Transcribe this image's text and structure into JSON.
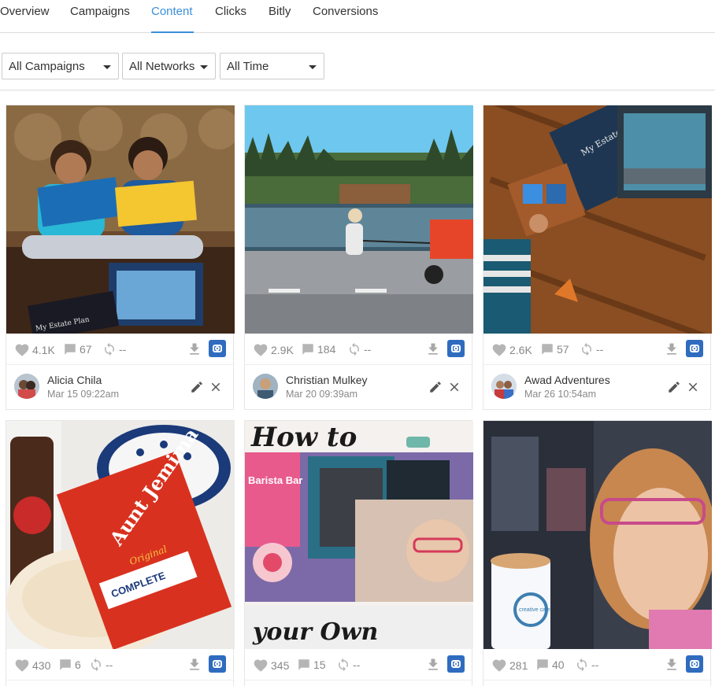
{
  "tabs": [
    {
      "label": "Overview"
    },
    {
      "label": "Campaigns"
    },
    {
      "label": "Content",
      "active": true
    },
    {
      "label": "Clicks"
    },
    {
      "label": "Bitly"
    },
    {
      "label": "Conversions"
    }
  ],
  "filters": {
    "campaigns": "All Campaigns",
    "networks": "All Networks",
    "time": "All Time"
  },
  "colors": {
    "accent": "#3a8fd9",
    "instagram": "#2f6cbf",
    "muted": "#888888"
  },
  "cards": [
    {
      "likes": "4.1K",
      "comments": "67",
      "reposts": "--",
      "author": "Alicia Chila",
      "date": "Mar 15 09:22am",
      "network_icon": "instagram-icon"
    },
    {
      "likes": "2.9K",
      "comments": "184",
      "reposts": "--",
      "author": "Christian Mulkey",
      "date": "Mar 20 09:39am",
      "network_icon": "instagram-icon"
    },
    {
      "likes": "2.6K",
      "comments": "57",
      "reposts": "--",
      "author": "Awad Adventures",
      "date": "Mar 26 10:54am",
      "network_icon": "instagram-icon"
    },
    {
      "likes": "430",
      "comments": "6",
      "reposts": "--",
      "network_icon": "instagram-icon"
    },
    {
      "likes": "345",
      "comments": "15",
      "reposts": "--",
      "network_icon": "instagram-icon"
    },
    {
      "likes": "281",
      "comments": "40",
      "reposts": "--",
      "network_icon": "instagram-icon"
    }
  ],
  "photo_text": {
    "card1_book_cover": "My Estate Plan",
    "card3_book_cover": "My Estate Plan",
    "card4_box_brand": "Aunt Jemima",
    "card4_box_sub": "Original",
    "card4_box_label": "COMPLETE",
    "card5_headline_top": "How to",
    "card5_headline_bottom": "your Own",
    "card5_box_title": "Barista Bar",
    "card6_cup_text": "creative cafe"
  }
}
